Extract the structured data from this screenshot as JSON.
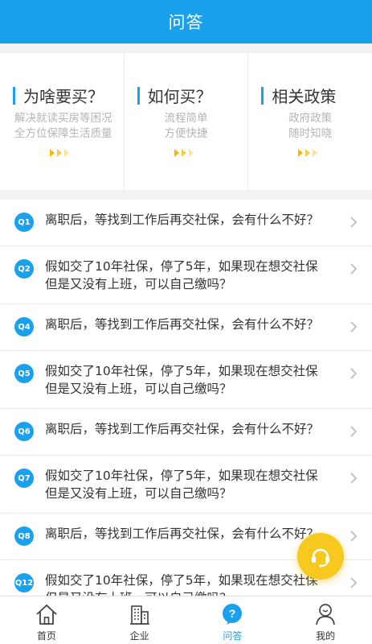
{
  "header": {
    "title": "问答"
  },
  "cards": [
    {
      "title": "为啥要买？",
      "lines": [
        "解决就读买房等困况",
        "全方位保障生活质量"
      ]
    },
    {
      "title": "如何买？",
      "lines": [
        "流程简单",
        "方便快捷"
      ]
    },
    {
      "title": "相关政策",
      "lines": [
        "政府政策",
        "随时知晓"
      ]
    }
  ],
  "questions": [
    {
      "badge": "Q1",
      "line1": "离职后，等找到工作后再交社保，会有什么不好？",
      "line2": ""
    },
    {
      "badge": "Q2",
      "line1": "假如交了10年社保，停了5年，如果现在想交社保",
      "line2": "但是又没有上班，可以自己缴吗？"
    },
    {
      "badge": "Q4",
      "line1": "离职后，等找到工作后再交社保，会有什么不好？",
      "line2": ""
    },
    {
      "badge": "Q5",
      "line1": "假如交了10年社保，停了5年，如果现在想交社保",
      "line2": "但是又没有上班，可以自己缴吗？"
    },
    {
      "badge": "Q6",
      "line1": "离职后，等找到工作后再交社保，会有什么不好？",
      "line2": ""
    },
    {
      "badge": "Q7",
      "line1": "假如交了10年社保，停了5年，如果现在想交社保",
      "line2": "但是又没有上班，可以自己缴吗？"
    },
    {
      "badge": "Q8",
      "line1": "离职后，等找到工作后再交社保，会有什么不好？",
      "line2": ""
    },
    {
      "badge": "Q12",
      "line1": "假如交了10年社保，停了5年，如果现在想交社保",
      "line2": "但是又没有上班，可以自己缴吗？"
    }
  ],
  "tabs": [
    {
      "label": "首页",
      "icon": "home-icon"
    },
    {
      "label": "企业",
      "icon": "building-icon"
    },
    {
      "label": "问答",
      "icon": "question-bubble-icon"
    },
    {
      "label": "我的",
      "icon": "user-icon"
    }
  ],
  "colors": {
    "primary": "#1aa1ee",
    "accent": "#f7c81e"
  }
}
